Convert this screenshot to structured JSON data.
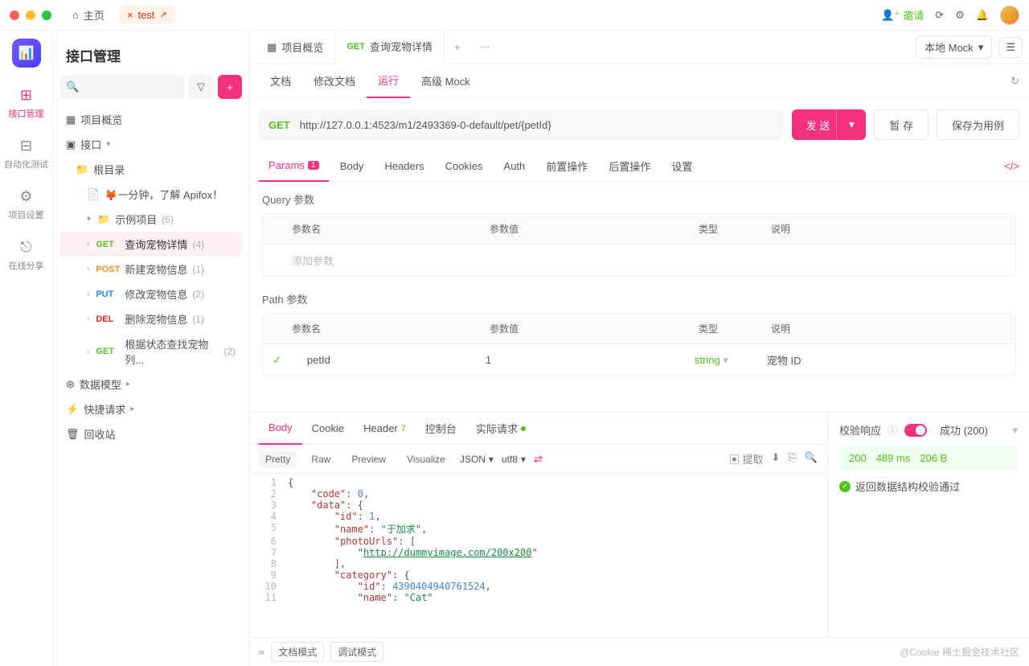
{
  "titlebar": {
    "home": "主页",
    "tab_close": "×",
    "tab_name": "test",
    "invite": "邀请"
  },
  "rail": {
    "items": [
      {
        "label": "接口管理"
      },
      {
        "label": "自动化测试"
      },
      {
        "label": "项目设置"
      },
      {
        "label": "在线分享"
      }
    ]
  },
  "sidebar": {
    "title": "接口管理",
    "search_placeholder": "",
    "project_overview": "项目概览",
    "api_root": "接口",
    "root_dir": "根目录",
    "intro": "🦊一分钟，了解 Apifox！",
    "example_project": "示例项目",
    "example_count": "(5)",
    "endpoints": [
      {
        "method": "GET",
        "name": "查询宠物详情",
        "count": "(4)"
      },
      {
        "method": "POST",
        "name": "新建宠物信息",
        "count": "(1)"
      },
      {
        "method": "PUT",
        "name": "修改宠物信息",
        "count": "(2)"
      },
      {
        "method": "DEL",
        "name": "删除宠物信息",
        "count": "(1)"
      },
      {
        "method": "GET",
        "name": "根据状态查找宠物列...",
        "count": "(2)"
      }
    ],
    "data_model": "数据模型",
    "quick_request": "快捷请求",
    "trash": "回收站"
  },
  "tabs": {
    "overview": "项目概览",
    "current": "查询宠物详情",
    "env": "本地 Mock"
  },
  "subtabs": {
    "doc": "文档",
    "edit": "修改文档",
    "run": "运行",
    "mock": "高级 Mock"
  },
  "request": {
    "method": "GET",
    "url": "http://127.0.0.1:4523/m1/2493369-0-default/pet/{petId}",
    "send": "发 送",
    "save_temp": "暂 存",
    "save_case": "保存为用例"
  },
  "param_tabs": {
    "params": "Params",
    "params_badge": "1",
    "body": "Body",
    "headers": "Headers",
    "cookies": "Cookies",
    "auth": "Auth",
    "pre": "前置操作",
    "post": "后置操作",
    "settings": "设置"
  },
  "query": {
    "title": "Query 参数",
    "col_name": "参数名",
    "col_value": "参数值",
    "col_type": "类型",
    "col_desc": "说明",
    "add": "添加参数"
  },
  "path": {
    "title": "Path 参数",
    "col_name": "参数名",
    "col_value": "参数值",
    "col_type": "类型",
    "col_desc": "说明",
    "row": {
      "name": "petId",
      "value": "1",
      "type": "string",
      "desc": "宠物 ID"
    }
  },
  "response": {
    "tabs": {
      "body": "Body",
      "cookie": "Cookie",
      "header": "Header",
      "header_badge": "7",
      "console": "控制台",
      "actual": "实际请求"
    },
    "modes": {
      "pretty": "Pretty",
      "raw": "Raw",
      "preview": "Preview",
      "visualize": "Visualize"
    },
    "format": "JSON",
    "encoding": "utf8",
    "extract": "提取"
  },
  "validate": {
    "label": "校验响应",
    "success": "成功 (200)",
    "status_code": "200",
    "time": "489 ms",
    "size": "206 B",
    "ok_msg": "返回数据结构校验通过"
  },
  "footer": {
    "doc_mode": "文档模式",
    "debug_mode": "调试模式",
    "watermark": "@Cookie 稀土掘金技术社区"
  },
  "code": {
    "lines": [
      {
        "n": "1",
        "content": [
          {
            "t": "brace",
            "v": "{"
          }
        ]
      },
      {
        "n": "2",
        "content": [
          {
            "t": "pad",
            "v": "    "
          },
          {
            "t": "key",
            "v": "\"code\""
          },
          {
            "t": "brace",
            "v": ": "
          },
          {
            "t": "num",
            "v": "0"
          },
          {
            "t": "brace",
            "v": ","
          }
        ]
      },
      {
        "n": "3",
        "content": [
          {
            "t": "pad",
            "v": "    "
          },
          {
            "t": "key",
            "v": "\"data\""
          },
          {
            "t": "brace",
            "v": ": {"
          }
        ]
      },
      {
        "n": "4",
        "content": [
          {
            "t": "pad",
            "v": "        "
          },
          {
            "t": "key",
            "v": "\"id\""
          },
          {
            "t": "brace",
            "v": ": "
          },
          {
            "t": "num",
            "v": "1"
          },
          {
            "t": "brace",
            "v": ","
          }
        ]
      },
      {
        "n": "5",
        "content": [
          {
            "t": "pad",
            "v": "        "
          },
          {
            "t": "key",
            "v": "\"name\""
          },
          {
            "t": "brace",
            "v": ": "
          },
          {
            "t": "str",
            "v": "\"于加求\""
          },
          {
            "t": "brace",
            "v": ","
          }
        ]
      },
      {
        "n": "6",
        "content": [
          {
            "t": "pad",
            "v": "        "
          },
          {
            "t": "key",
            "v": "\"photoUrls\""
          },
          {
            "t": "brace",
            "v": ": ["
          }
        ]
      },
      {
        "n": "7",
        "content": [
          {
            "t": "pad",
            "v": "            "
          },
          {
            "t": "brace",
            "v": "\""
          },
          {
            "t": "url",
            "v": "http://dummyimage.com/200x200"
          },
          {
            "t": "brace",
            "v": "\""
          }
        ]
      },
      {
        "n": "8",
        "content": [
          {
            "t": "pad",
            "v": "        "
          },
          {
            "t": "brace",
            "v": "],"
          }
        ]
      },
      {
        "n": "9",
        "content": [
          {
            "t": "pad",
            "v": "        "
          },
          {
            "t": "key",
            "v": "\"category\""
          },
          {
            "t": "brace",
            "v": ": {"
          }
        ]
      },
      {
        "n": "10",
        "content": [
          {
            "t": "pad",
            "v": "            "
          },
          {
            "t": "key",
            "v": "\"id\""
          },
          {
            "t": "brace",
            "v": ": "
          },
          {
            "t": "num",
            "v": "4390404940761524"
          },
          {
            "t": "brace",
            "v": ","
          }
        ]
      },
      {
        "n": "11",
        "content": [
          {
            "t": "pad",
            "v": "            "
          },
          {
            "t": "key",
            "v": "\"name\""
          },
          {
            "t": "brace",
            "v": ": "
          },
          {
            "t": "str",
            "v": "\"Cat\""
          }
        ]
      }
    ]
  }
}
